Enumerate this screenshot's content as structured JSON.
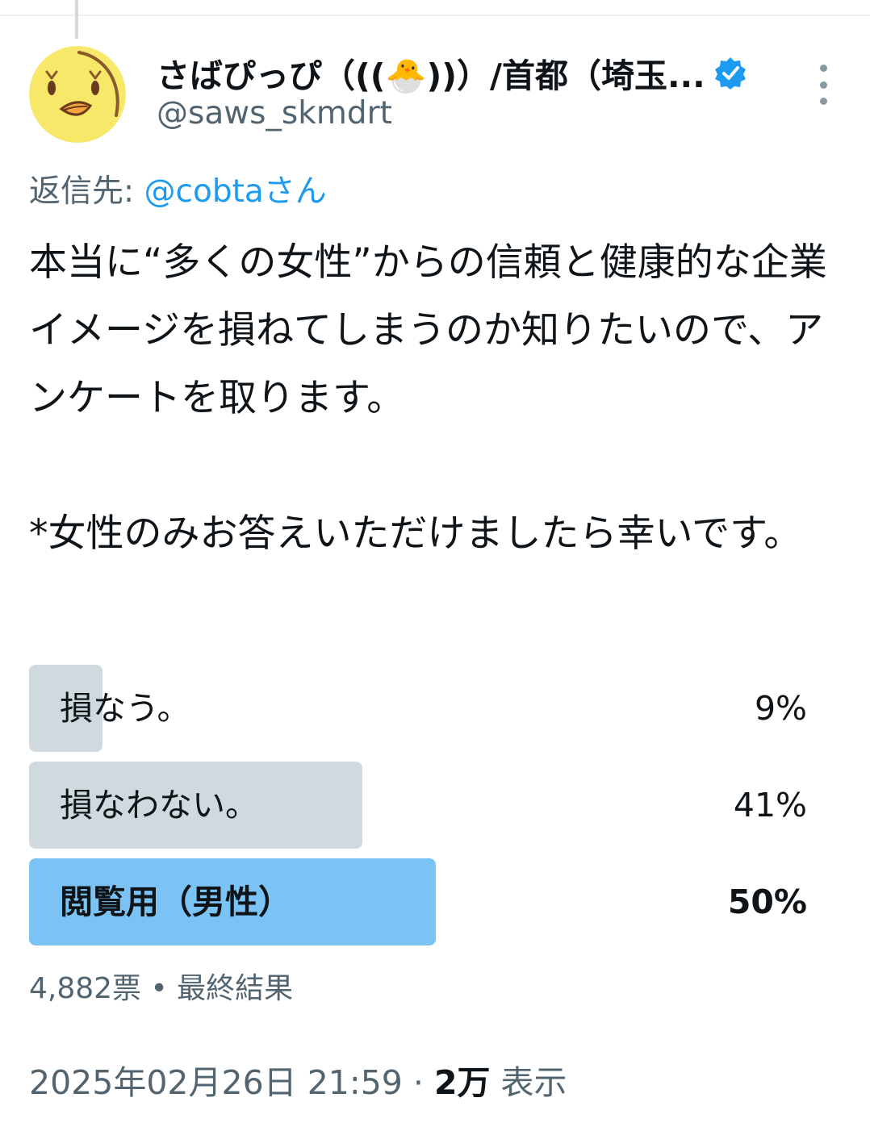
{
  "author": {
    "display_name": "さばぴっぴ（((🐣))）/首都（埼玉...",
    "handle": "@saws_skmdrt",
    "verified": true
  },
  "reply": {
    "prefix": "返信先: ",
    "mention": "@cobtaさん"
  },
  "tweet": {
    "text": "本当に“多くの女性”からの信頼と健康的な企業イメージを損ねてしまうのか知りたいので、アンケートを取ります。\n\n*女性のみお答えいただけましたら幸いです。"
  },
  "poll": {
    "options": [
      {
        "label": "損なう。",
        "percent_text": "9%",
        "fraction": 0.09,
        "winner": false
      },
      {
        "label": "損なわない。",
        "percent_text": "41%",
        "fraction": 0.41,
        "winner": false
      },
      {
        "label": "閲覧用（男性）",
        "percent_text": "50%",
        "fraction": 0.5,
        "winner": true
      }
    ],
    "meta": "4,882票 • 最終結果"
  },
  "footer": {
    "timestamp": "2025年02月26日 21:59 · ",
    "views_count": "2万",
    "views_label": " 表示"
  },
  "colors": {
    "accent": "#1d9bf0",
    "poll_bar": "#cfd9de",
    "poll_bar_winner": "#7cc3f5",
    "secondary_text": "#536471"
  }
}
